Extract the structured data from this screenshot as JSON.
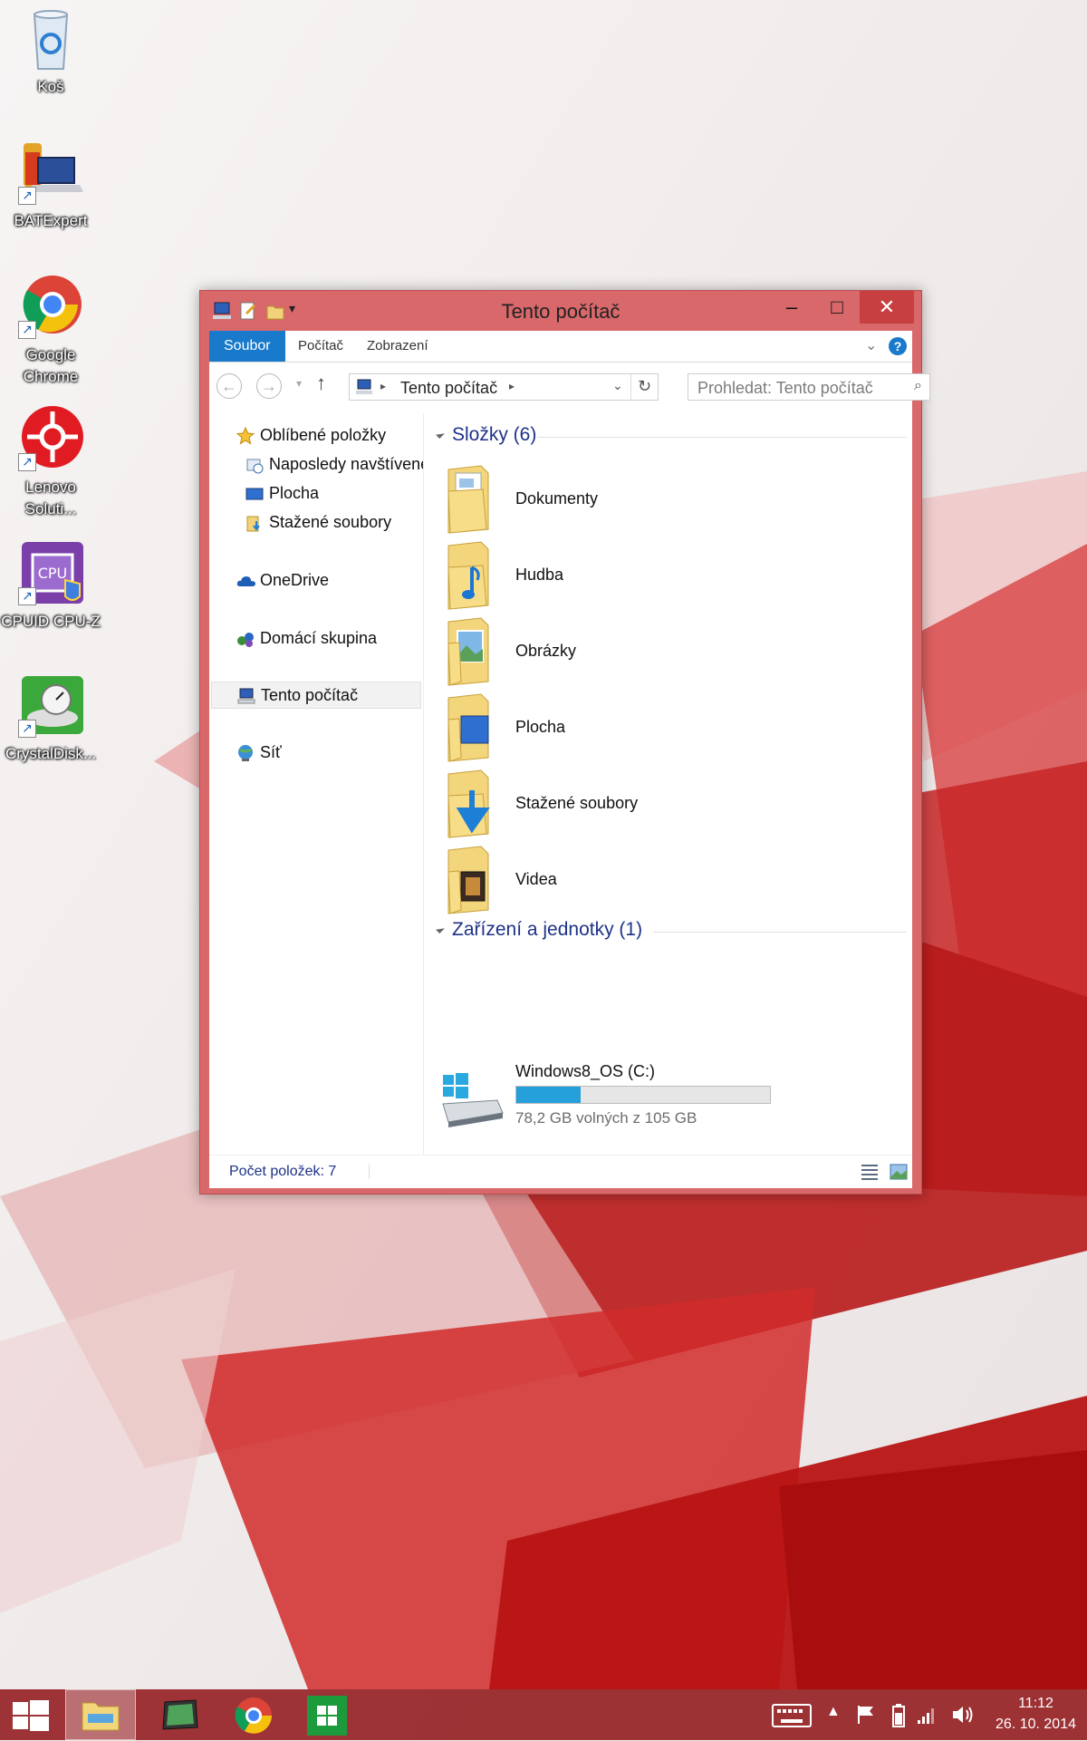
{
  "desktop": {
    "icons": [
      {
        "label": "Koš",
        "icon": "recycle-bin-icon"
      },
      {
        "label": "BATExpert",
        "icon": "batexpert-icon"
      },
      {
        "label": "Google Chrome",
        "icon": "chrome-icon"
      },
      {
        "label": "Lenovo Soluti...",
        "icon": "lenovo-solutions-icon"
      },
      {
        "label": "CPUID CPU-Z",
        "icon": "cpuz-icon"
      },
      {
        "label": "CrystalDisk...",
        "icon": "crystaldisk-icon"
      }
    ]
  },
  "window": {
    "title": "Tento počítač",
    "controls": {
      "minimize": "–",
      "maximize": "□",
      "close": "✕"
    },
    "ribbon": {
      "file_tab": "Soubor",
      "tabs": [
        "Počítač",
        "Zobrazení"
      ]
    },
    "address": {
      "location": "Tento počítač"
    },
    "search": {
      "placeholder": "Prohledat: Tento počítač"
    },
    "navpane": {
      "favorites": "Oblíbené položky",
      "recent": "Naposledy navštívené",
      "desktop": "Plocha",
      "downloads": "Stažené soubory",
      "onedrive": "OneDrive",
      "homegroup": "Domácí skupina",
      "thispc": "Tento počítač",
      "network": "Síť"
    },
    "folders_group": "Složky (6)",
    "folders": [
      "Dokumenty",
      "Hudba",
      "Obrázky",
      "Plocha",
      "Stažené soubory",
      "Videa"
    ],
    "devices_group": "Zařízení a jednotky (1)",
    "drive": {
      "name": "Windows8_OS (C:)",
      "free_text": "78,2 GB volných z 105 GB",
      "used_fraction": 0.255
    },
    "status": {
      "item_count": "Počet položek: 7"
    }
  },
  "taskbar": {
    "time": "11:12",
    "date": "26. 10. 2014"
  },
  "colors": {
    "accent": "#1979ca",
    "window_frame": "#d9686a",
    "close": "#c7403f",
    "group_header": "#1e3287",
    "drive_fill": "#26a0da",
    "taskbar": "#962326"
  }
}
